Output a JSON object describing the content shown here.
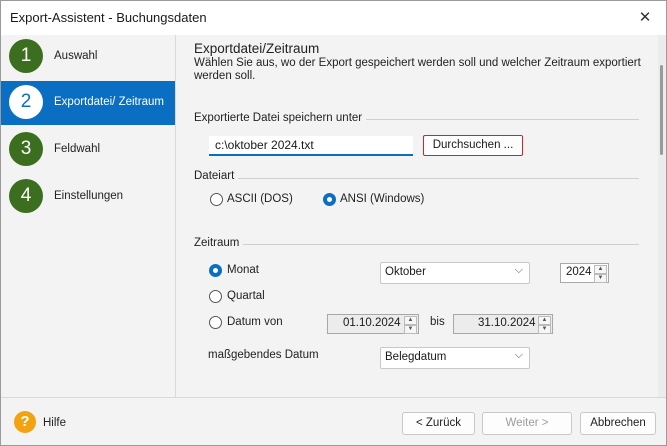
{
  "window": {
    "title": "Export-Assistent - Buchungsdaten",
    "close_glyph": "✕"
  },
  "steps": [
    {
      "num": "1",
      "label": "Auswahl"
    },
    {
      "num": "2",
      "label": "Exportdatei/ Zeitraum"
    },
    {
      "num": "3",
      "label": "Feldwahl"
    },
    {
      "num": "4",
      "label": "Einstellungen"
    }
  ],
  "header": {
    "title": "Exportdatei/Zeitraum",
    "description": "Wählen Sie aus, wo der Export gespeichert werden soll und welcher Zeitraum exportiert werden soll."
  },
  "file": {
    "group_label": "Exportierte Datei speichern unter",
    "path": "c:\\oktober 2024.txt",
    "browse_label": "Durchsuchen ..."
  },
  "filetype": {
    "group_label": "Dateiart",
    "options": [
      "ASCII (DOS)",
      "ANSI (Windows)"
    ],
    "selected": "ANSI (Windows)"
  },
  "period": {
    "group_label": "Zeitraum",
    "options": [
      "Monat",
      "Quartal",
      "Datum von"
    ],
    "selected": "Monat",
    "month": "Oktober",
    "year": "2024",
    "date_from": "01.10.2024",
    "to_label": "bis",
    "date_to": "31.10.2024",
    "basis_label": "maßgebendes Datum",
    "basis_value": "Belegdatum"
  },
  "footer": {
    "help_glyph": "?",
    "help_label": "Hilfe",
    "back_label": "< Zurück",
    "next_label": "Weiter >",
    "cancel_label": "Abbrechen"
  },
  "icons": {
    "chevron": "⌵",
    "spin_up": "▲",
    "spin_down": "▼"
  },
  "colors": {
    "accent": "#0a6fc2",
    "step_green": "#3b6e1e",
    "browse_border": "#d1232a",
    "help": "#f2a30f"
  }
}
